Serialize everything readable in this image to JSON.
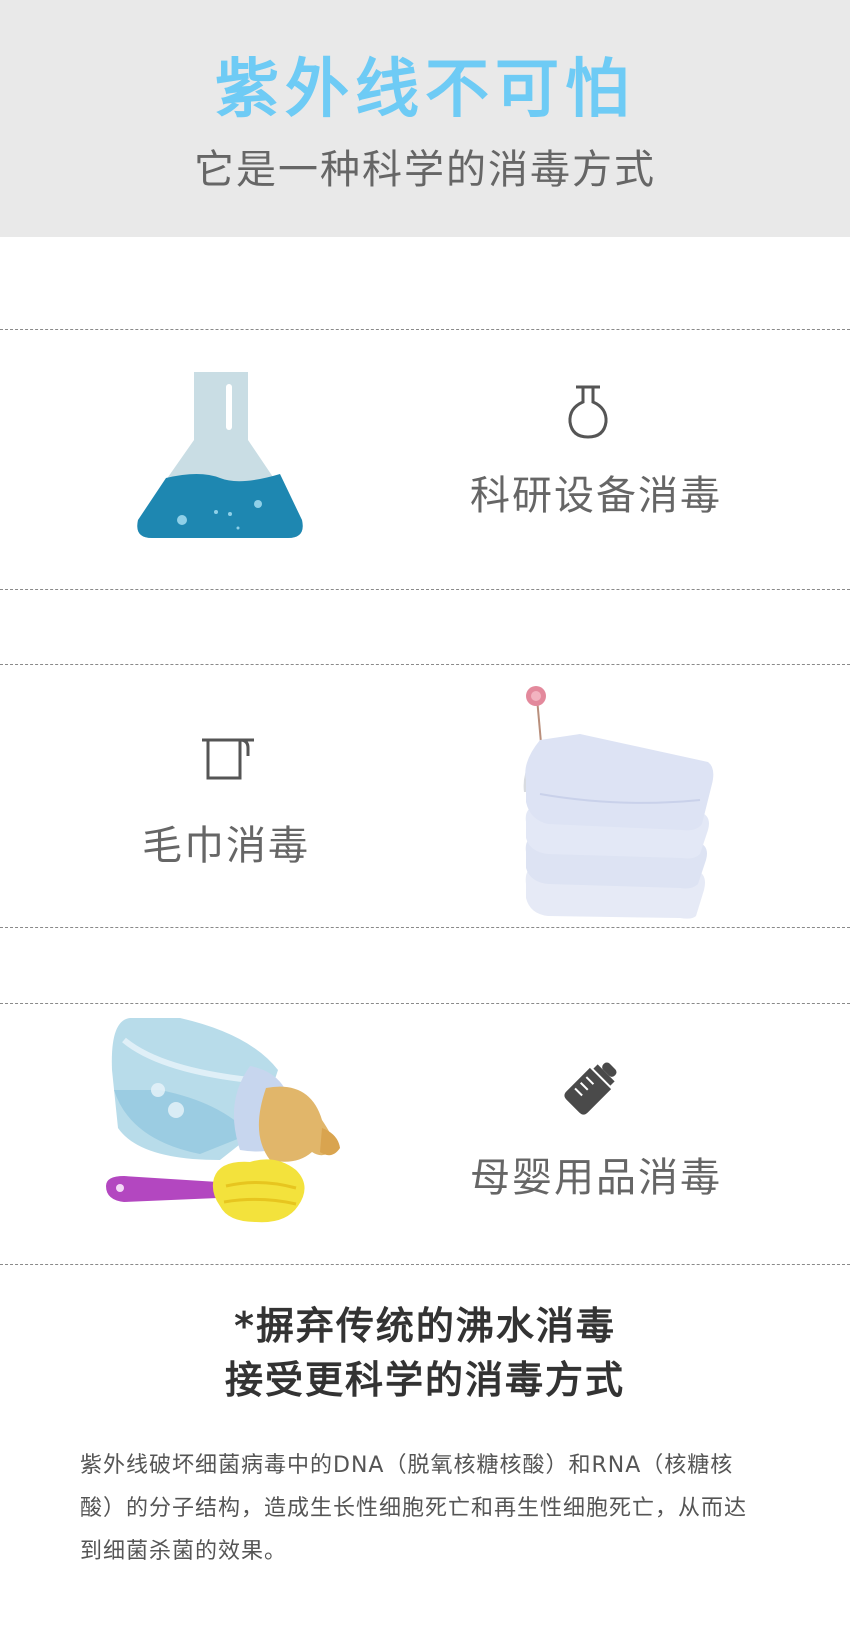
{
  "header": {
    "title": "紫外线不可怕",
    "subtitle": "它是一种科学的消毒方式"
  },
  "sections": [
    {
      "label": "科研设备消毒",
      "icon": "flask-icon",
      "image": "lab-flask-image"
    },
    {
      "label": "毛巾消毒",
      "icon": "towel-icon",
      "image": "folded-towels-image"
    },
    {
      "label": "母婴用品消毒",
      "icon": "baby-bottle-icon",
      "image": "baby-bottle-image"
    }
  ],
  "slogan": {
    "line1": "*摒弃传统的沸水消毒",
    "line2": "接受更科学的消毒方式"
  },
  "description": "紫外线破坏细菌病毒中的DNA（脱氧核糖核酸）和RNA（核糖核酸）的分子结构，造成生长性细胞死亡和再生性细胞死亡，从而达到细菌杀菌的效果。",
  "colors": {
    "accent": "#6ecbf5",
    "header_bg": "#e9e9e9",
    "text": "#666666"
  }
}
